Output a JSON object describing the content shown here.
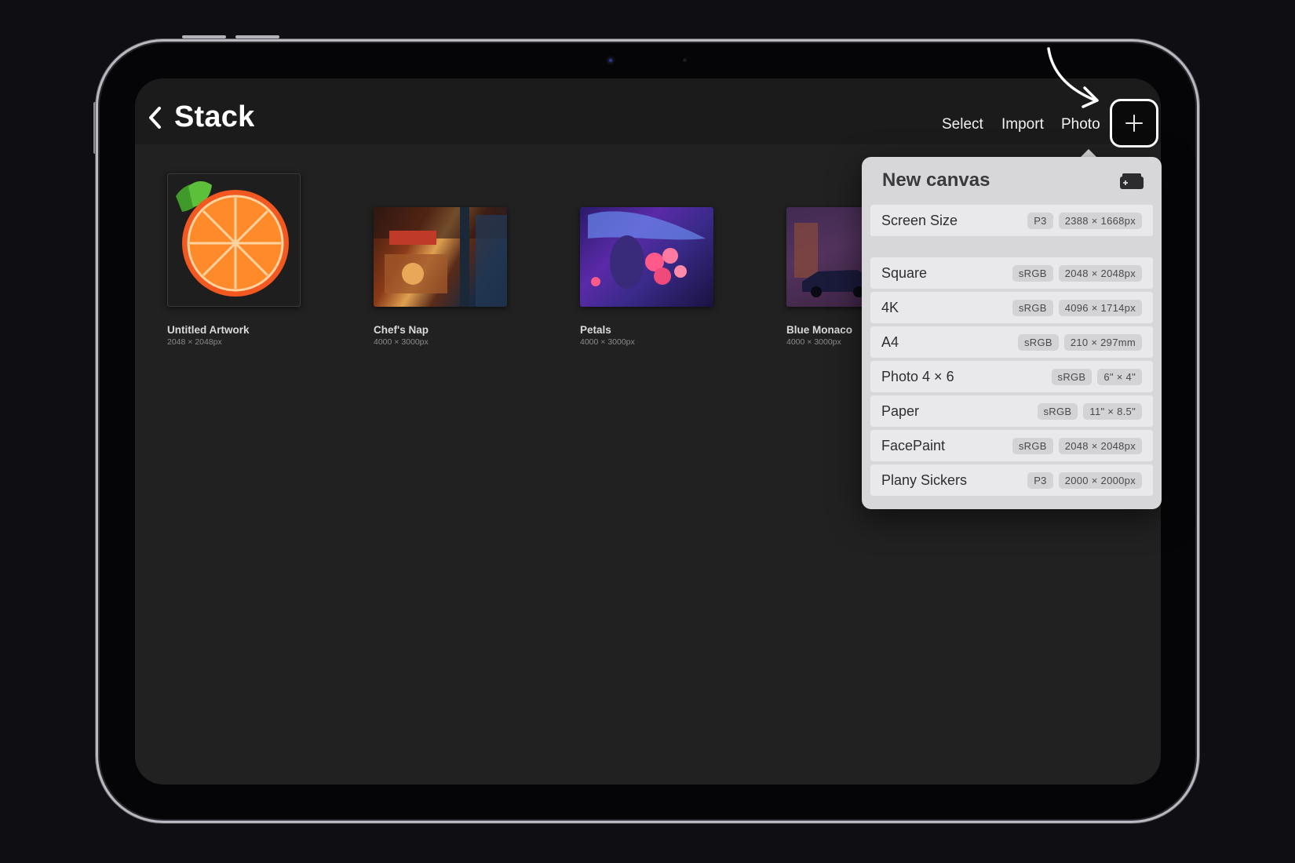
{
  "header": {
    "title": "Stack",
    "actions": {
      "select": "Select",
      "import": "Import",
      "photo": "Photo"
    }
  },
  "gallery": [
    {
      "name": "Untitled Artwork",
      "size": "2048 × 2048px"
    },
    {
      "name": "Chef's Nap",
      "size": "4000 × 3000px"
    },
    {
      "name": "Petals",
      "size": "4000 × 3000px"
    },
    {
      "name": "Blue Monaco",
      "size": "4000 × 3000px"
    }
  ],
  "new_canvas": {
    "title": "New canvas",
    "presets": [
      {
        "name": "Screen Size",
        "color_profile": "P3",
        "dimensions": "2388 × 1668px"
      },
      {
        "name": "Square",
        "color_profile": "sRGB",
        "dimensions": "2048 × 2048px"
      },
      {
        "name": "4K",
        "color_profile": "sRGB",
        "dimensions": "4096 × 1714px"
      },
      {
        "name": "A4",
        "color_profile": "sRGB",
        "dimensions": "210 × 297mm"
      },
      {
        "name": "Photo 4 × 6",
        "color_profile": "sRGB",
        "dimensions": "6\" × 4\""
      },
      {
        "name": "Paper",
        "color_profile": "sRGB",
        "dimensions": "11\" × 8.5\""
      },
      {
        "name": "FacePaint",
        "color_profile": "sRGB",
        "dimensions": "2048 × 2048px"
      },
      {
        "name": "Plany Sickers",
        "color_profile": "P3",
        "dimensions": "2000 × 2000px"
      }
    ]
  },
  "colors": {
    "screen_bg": "#212121",
    "topbar_bg": "#1b1b1b",
    "popover_bg": "#d7d7d9",
    "row_bg": "#e9e9eb",
    "orange": "#f2581f"
  },
  "icons": [
    "chevron-left-icon",
    "plus-icon",
    "new-canvas-add-icon",
    "annotation-arrow-icon"
  ]
}
